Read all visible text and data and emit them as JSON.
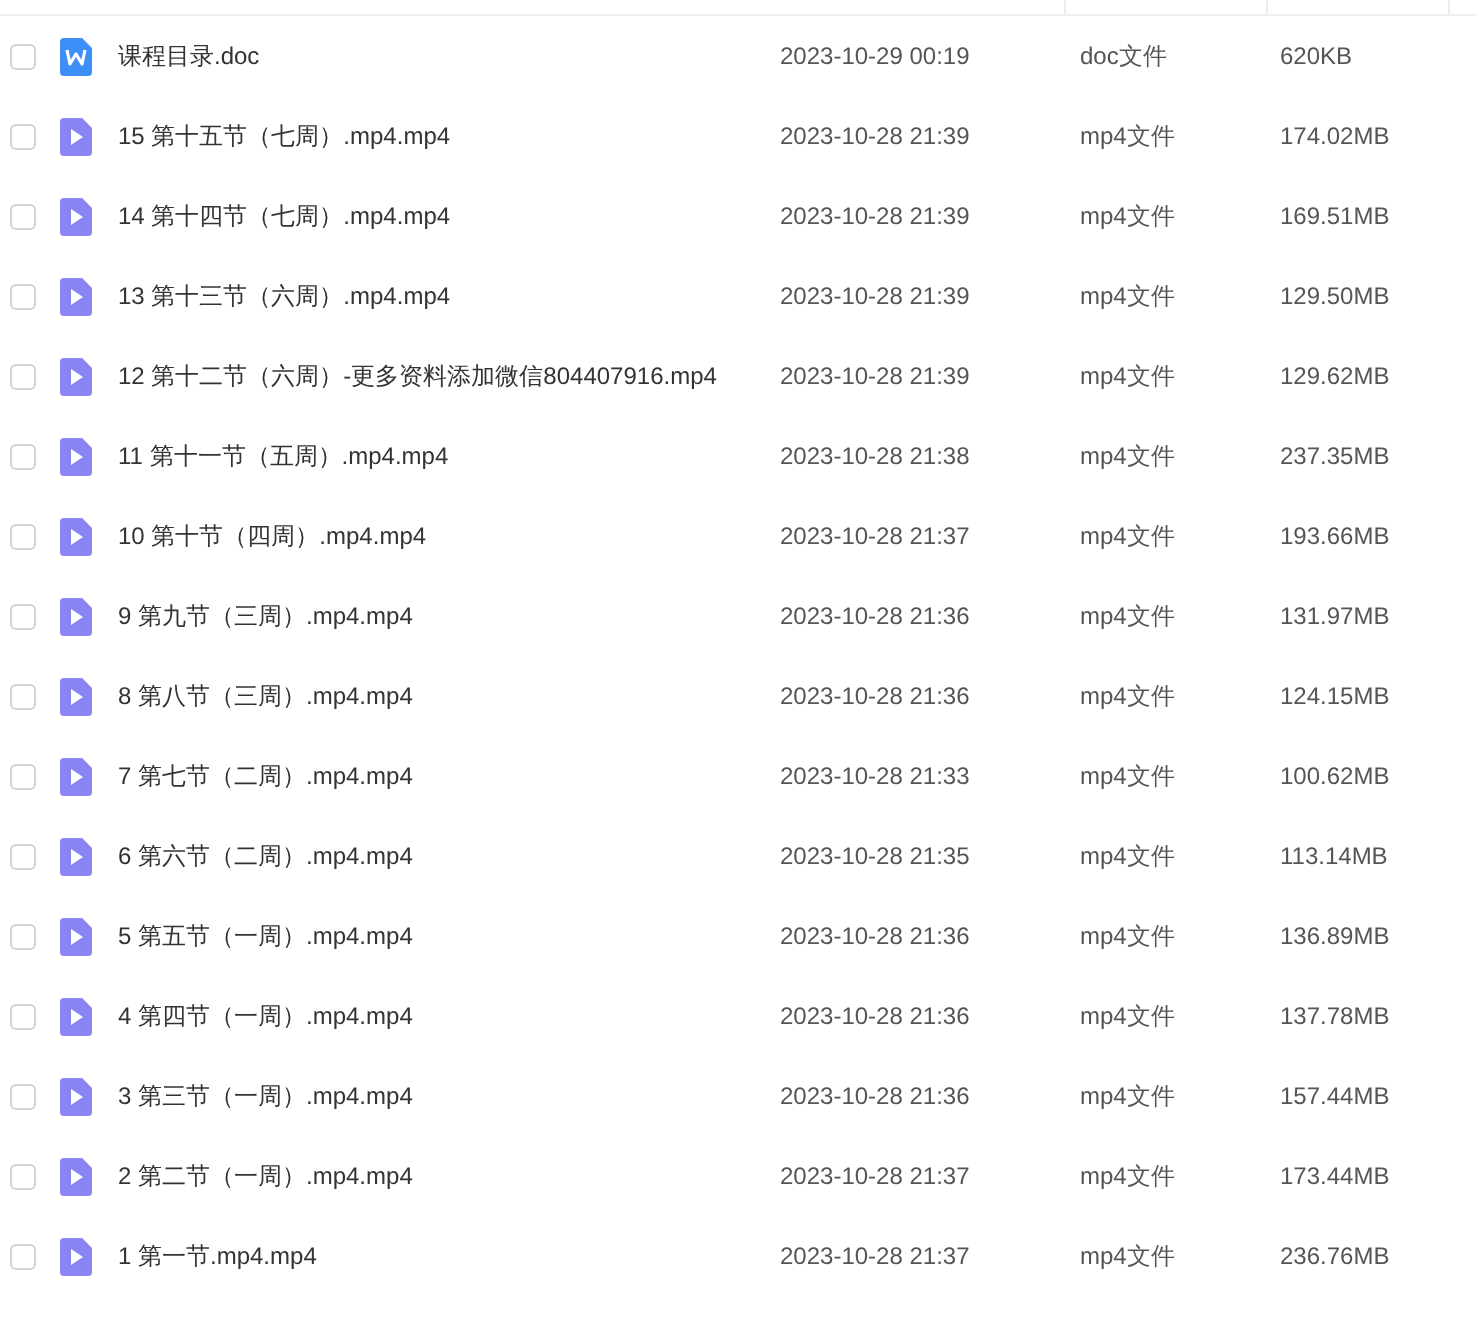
{
  "files": [
    {
      "kind": "doc",
      "name": "课程目录.doc",
      "modified": "2023-10-29 00:19",
      "type": "doc文件",
      "size": "620KB",
      "checked": false
    },
    {
      "kind": "video",
      "name": "15 第十五节（七周）.mp4.mp4",
      "modified": "2023-10-28 21:39",
      "type": "mp4文件",
      "size": "174.02MB",
      "checked": false
    },
    {
      "kind": "video",
      "name": "14 第十四节（七周）.mp4.mp4",
      "modified": "2023-10-28 21:39",
      "type": "mp4文件",
      "size": "169.51MB",
      "checked": false
    },
    {
      "kind": "video",
      "name": "13 第十三节（六周）.mp4.mp4",
      "modified": "2023-10-28 21:39",
      "type": "mp4文件",
      "size": "129.50MB",
      "checked": false
    },
    {
      "kind": "video",
      "name": "12 第十二节（六周）-更多资料添加微信804407916.mp4",
      "modified": "2023-10-28 21:39",
      "type": "mp4文件",
      "size": "129.62MB",
      "checked": false
    },
    {
      "kind": "video",
      "name": "11 第十一节（五周）.mp4.mp4",
      "modified": "2023-10-28 21:38",
      "type": "mp4文件",
      "size": "237.35MB",
      "checked": false
    },
    {
      "kind": "video",
      "name": "10 第十节（四周）.mp4.mp4",
      "modified": "2023-10-28 21:37",
      "type": "mp4文件",
      "size": "193.66MB",
      "checked": false
    },
    {
      "kind": "video",
      "name": "9 第九节（三周）.mp4.mp4",
      "modified": "2023-10-28 21:36",
      "type": "mp4文件",
      "size": "131.97MB",
      "checked": false
    },
    {
      "kind": "video",
      "name": "8 第八节（三周）.mp4.mp4",
      "modified": "2023-10-28 21:36",
      "type": "mp4文件",
      "size": "124.15MB",
      "checked": false
    },
    {
      "kind": "video",
      "name": "7 第七节（二周）.mp4.mp4",
      "modified": "2023-10-28 21:33",
      "type": "mp4文件",
      "size": "100.62MB",
      "checked": false
    },
    {
      "kind": "video",
      "name": "6 第六节（二周）.mp4.mp4",
      "modified": "2023-10-28 21:35",
      "type": "mp4文件",
      "size": "113.14MB",
      "checked": false
    },
    {
      "kind": "video",
      "name": "5 第五节（一周）.mp4.mp4",
      "modified": "2023-10-28 21:36",
      "type": "mp4文件",
      "size": "136.89MB",
      "checked": false
    },
    {
      "kind": "video",
      "name": "4 第四节（一周）.mp4.mp4",
      "modified": "2023-10-28 21:36",
      "type": "mp4文件",
      "size": "137.78MB",
      "checked": false
    },
    {
      "kind": "video",
      "name": "3 第三节（一周）.mp4.mp4",
      "modified": "2023-10-28 21:36",
      "type": "mp4文件",
      "size": "157.44MB",
      "checked": false
    },
    {
      "kind": "video",
      "name": "2 第二节（一周）.mp4.mp4",
      "modified": "2023-10-28 21:37",
      "type": "mp4文件",
      "size": "173.44MB",
      "checked": false
    },
    {
      "kind": "video",
      "name": "1 第一节.mp4.mp4",
      "modified": "2023-10-28 21:37",
      "type": "mp4文件",
      "size": "236.76MB",
      "checked": false
    }
  ]
}
